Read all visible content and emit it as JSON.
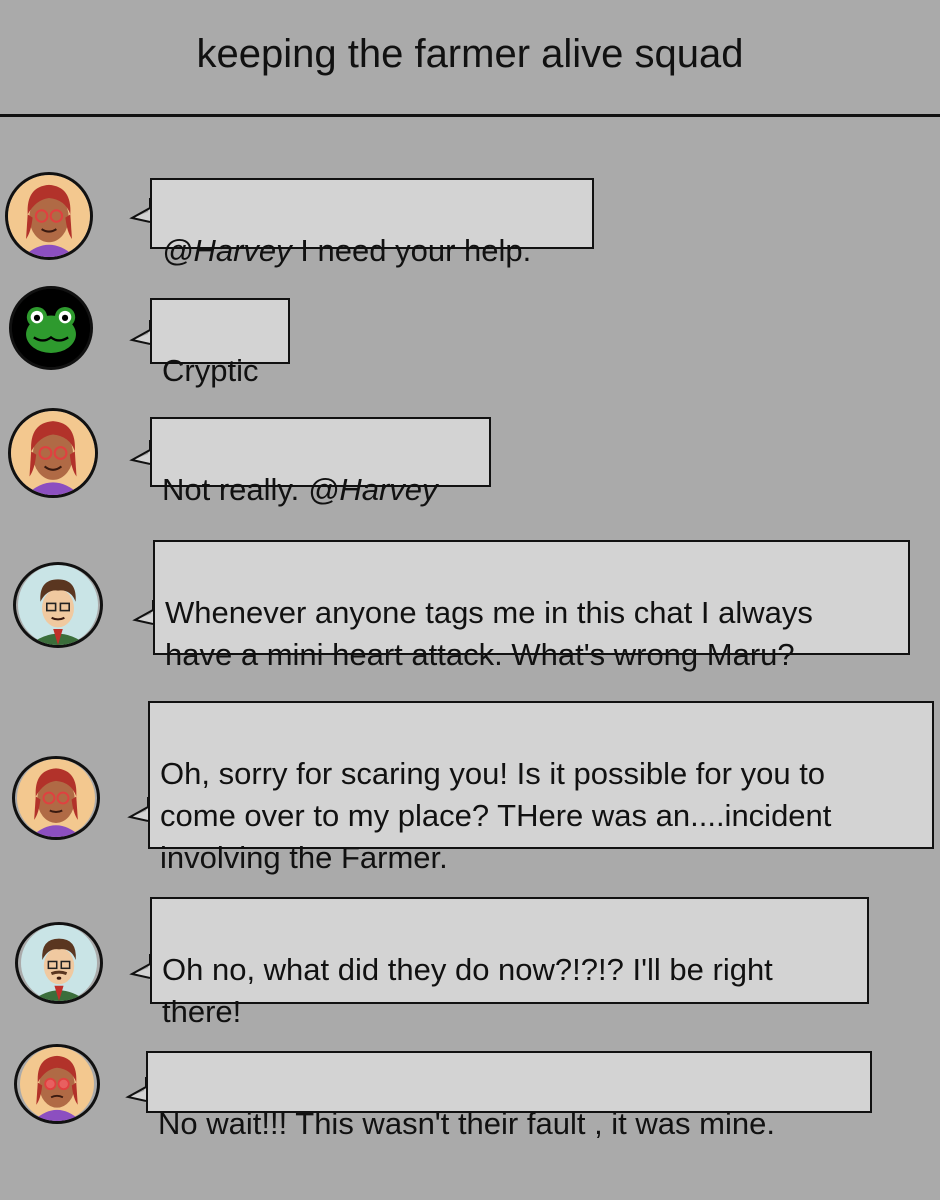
{
  "chat": {
    "title": "keeping the farmer alive squad"
  },
  "messages": [
    {
      "sender": "maru",
      "mention": "@Harvey",
      "text": " I need your help."
    },
    {
      "sender": "frog",
      "text": "Cryptic"
    },
    {
      "sender": "maru",
      "text": "Not really. ",
      "mention": "@Harvey"
    },
    {
      "sender": "harvey",
      "text": "Whenever anyone tags me in this chat I always\nhave a mini heart attack. What's wrong Maru?"
    },
    {
      "sender": "maru",
      "text": "Oh, sorry for scaring you! Is it possible for you to\ncome over to my place? THere was an....incident\ninvolving the Farmer."
    },
    {
      "sender": "harvey",
      "text": "Oh no, what did they do now?!?!? I'll be right\nthere!"
    },
    {
      "sender": "maru",
      "text": "No wait!!! This wasn't their fault , it was mine."
    }
  ],
  "colors": {
    "background": "#aaaaaa",
    "bubble": "#d3d3d3",
    "border": "#111111",
    "frog_green": "#2e9a2e"
  }
}
